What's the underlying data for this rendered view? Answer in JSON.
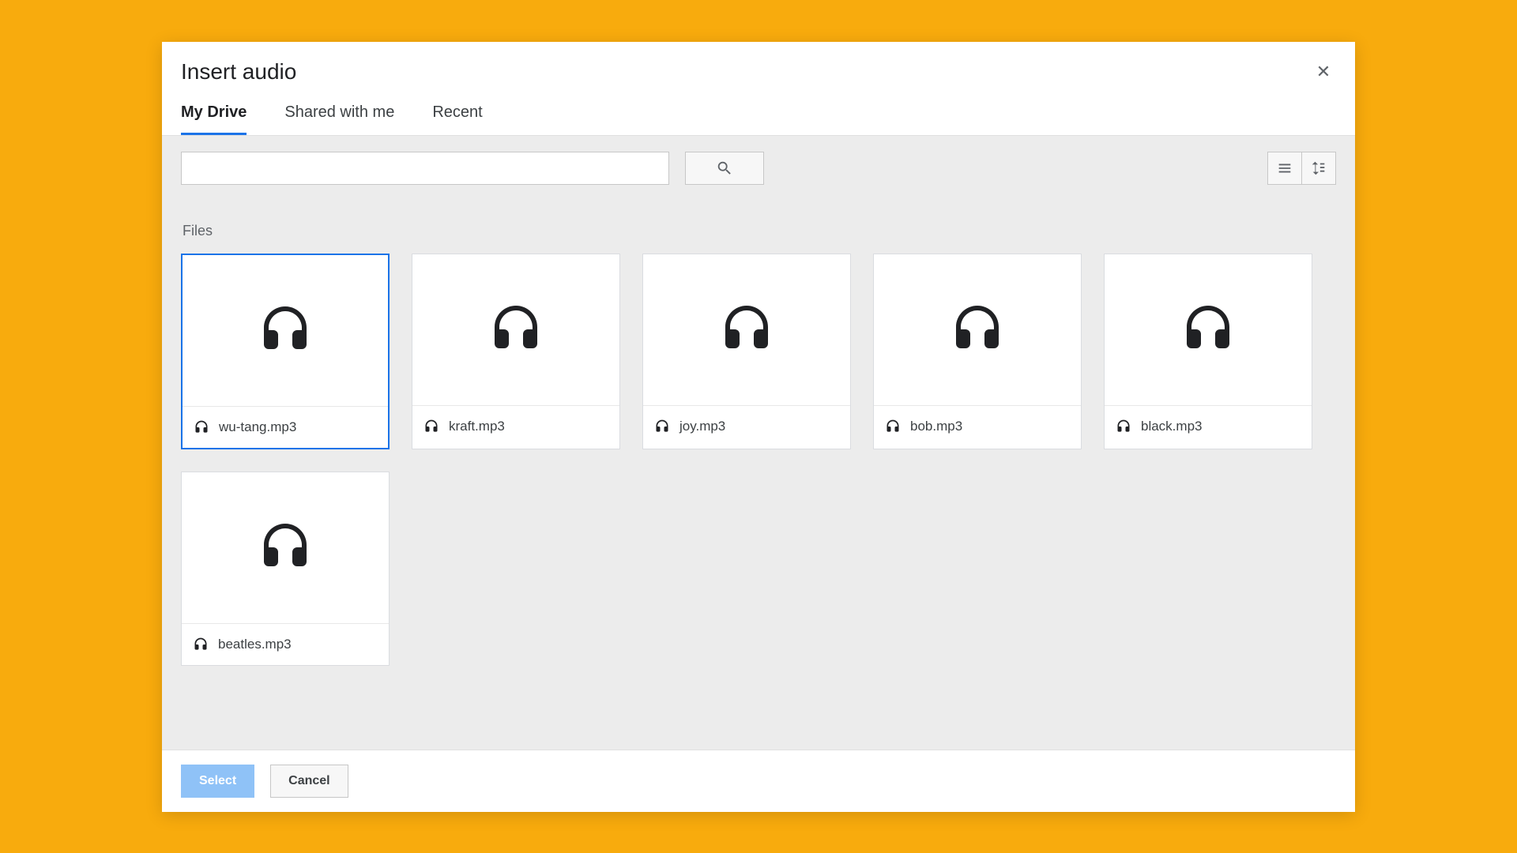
{
  "dialog": {
    "title": "Insert audio",
    "close_aria": "Close"
  },
  "tabs": [
    {
      "label": "My Drive",
      "active": true
    },
    {
      "label": "Shared with me",
      "active": false
    },
    {
      "label": "Recent",
      "active": false
    }
  ],
  "toolbar": {
    "search_value": "",
    "search_placeholder": ""
  },
  "section": {
    "files_label": "Files"
  },
  "files": [
    {
      "name": "wu-tang.mp3",
      "selected": true
    },
    {
      "name": "kraft.mp3",
      "selected": false
    },
    {
      "name": "joy.mp3",
      "selected": false
    },
    {
      "name": "bob.mp3",
      "selected": false
    },
    {
      "name": "black.mp3",
      "selected": false
    },
    {
      "name": "beatles.mp3",
      "selected": false
    }
  ],
  "footer": {
    "select_label": "Select",
    "cancel_label": "Cancel"
  },
  "colors": {
    "page_bg": "#F8AB0D",
    "accent": "#1a73e8",
    "select_btn": "#8fc2f7"
  }
}
